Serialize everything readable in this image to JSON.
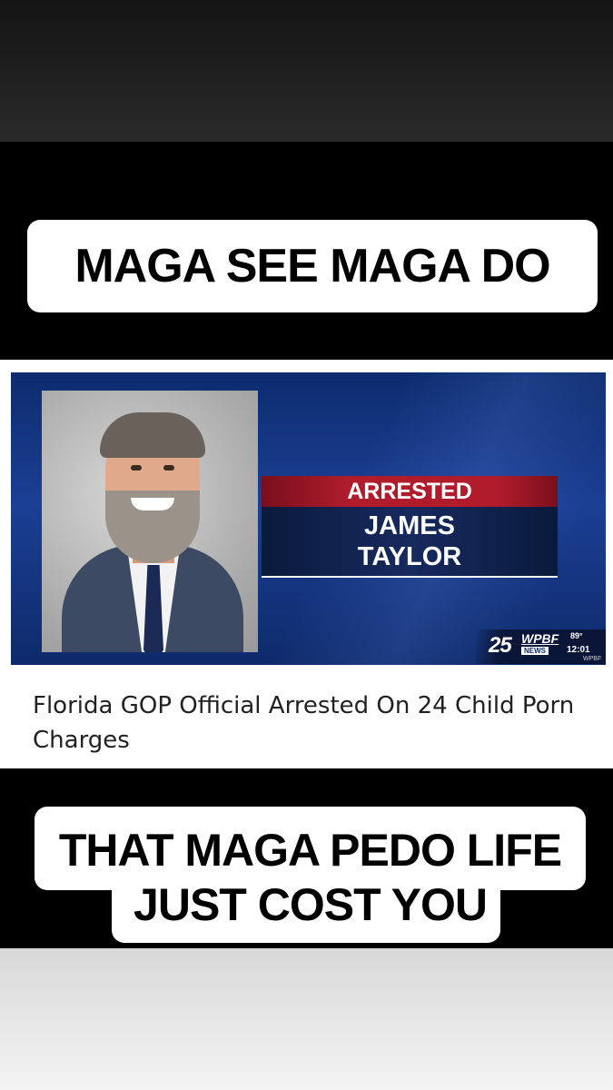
{
  "caption_top": "MAGA SEE MAGA DO",
  "news": {
    "lower_third": {
      "label": "ARRESTED",
      "name_line1": "JAMES",
      "name_line2": "TAYLOR"
    },
    "station": {
      "channel": "25",
      "call_sign": "WPBF",
      "news_tag": "NEWS",
      "temperature": "89°",
      "time": "12:01",
      "watermark": "WPBF"
    },
    "headline": "Florida GOP Official Arrested On 24 Child Porn Charges"
  },
  "caption_bottom": {
    "line1": "THAT MAGA PEDO LIFE",
    "line2": "JUST COST YOU"
  }
}
